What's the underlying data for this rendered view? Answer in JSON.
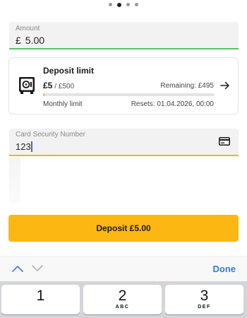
{
  "pager": {
    "count": 4,
    "active_index": 1
  },
  "amount_field": {
    "label": "Amount",
    "currency": "£",
    "value": "5.00"
  },
  "deposit_limit": {
    "title": "Deposit limit",
    "amount": "£5",
    "of_total": "/ £500",
    "remaining": "Remaining: £495",
    "period": "Monthly limit",
    "resets": "Resets: 01.04.2026, 00:00",
    "progress_fraction": 0.01,
    "icon": "safe-icon"
  },
  "card_security_field": {
    "label": "Card Security Number",
    "value": "123",
    "icon": "credit-card-icon"
  },
  "deposit_button": {
    "label": "Deposit £5.00",
    "color": "#fcb713"
  },
  "keyboard_toolbar": {
    "done_label": "Done",
    "up_icon": "chevron-up-icon",
    "down_icon": "chevron-down-icon",
    "accent": "#2f7de6"
  },
  "keypad": {
    "keys": [
      {
        "number": "1",
        "letters": ""
      },
      {
        "number": "2",
        "letters": "ABC"
      },
      {
        "number": "3",
        "letters": "DEF"
      }
    ]
  }
}
